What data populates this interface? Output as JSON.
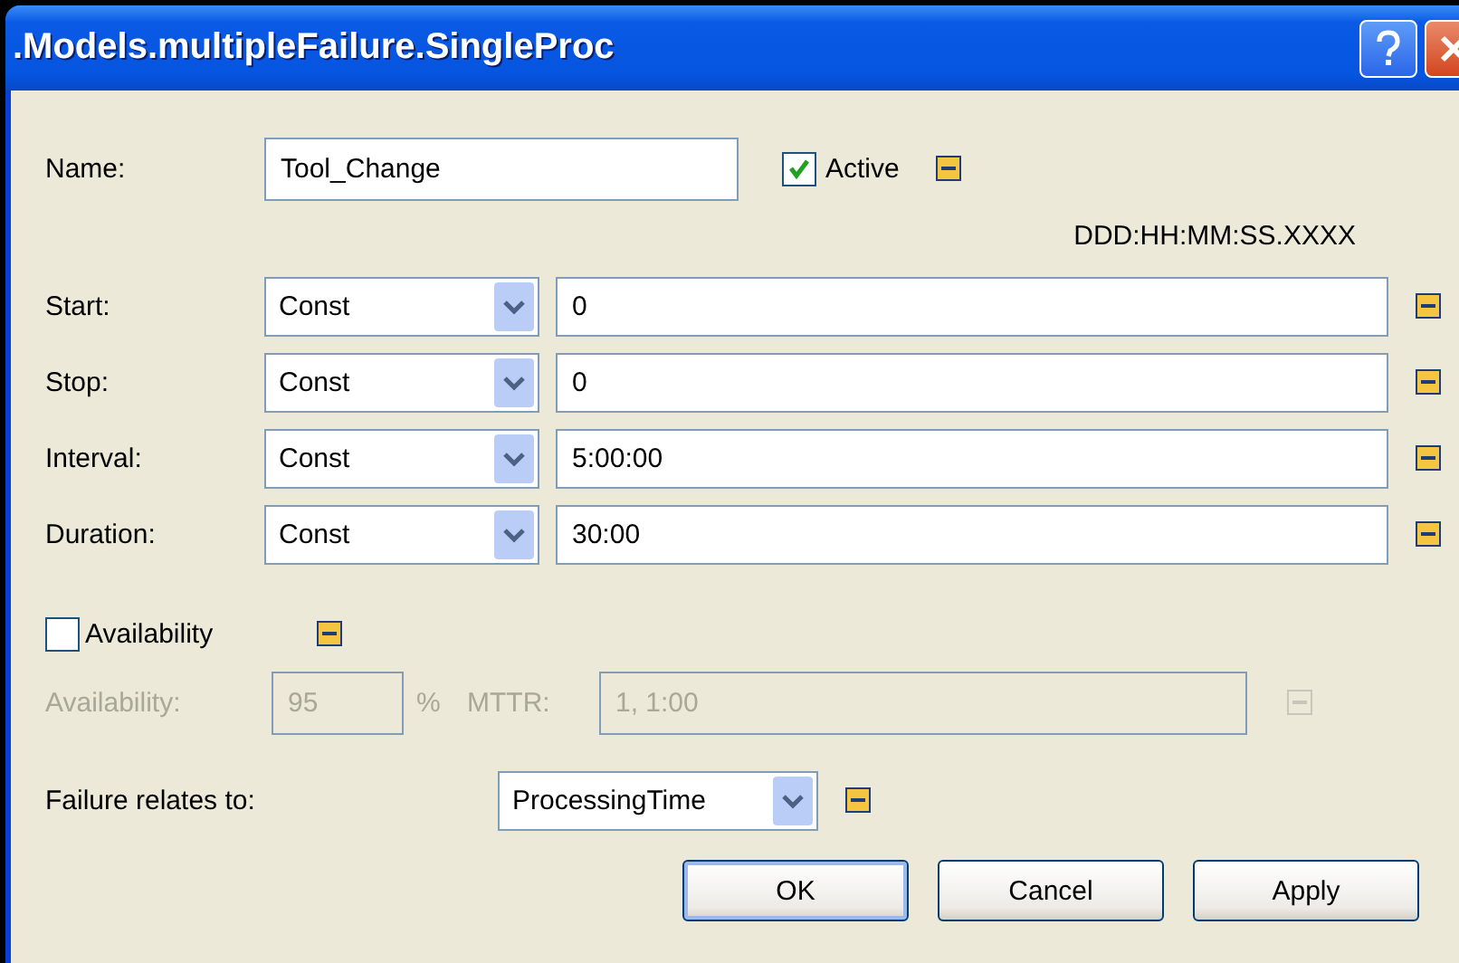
{
  "window": {
    "title": ".Models.multipleFailure.SingleProc"
  },
  "name": {
    "label": "Name:",
    "value": "Tool_Change"
  },
  "active": {
    "label": "Active",
    "checked": true
  },
  "format_hint": "DDD:HH:MM:SS.XXXX",
  "time_rows": [
    {
      "label": "Start:",
      "mode": "Const",
      "value": "0"
    },
    {
      "label": "Stop:",
      "mode": "Const",
      "value": "0"
    },
    {
      "label": "Interval:",
      "mode": "Const",
      "value": "5:00:00"
    },
    {
      "label": "Duration:",
      "mode": "Const",
      "value": "30:00"
    }
  ],
  "availability_toggle": {
    "label": "Availability",
    "checked": false
  },
  "availability_row": {
    "disabled": true,
    "label": "Availability:",
    "value": "95",
    "unit": "%",
    "mttr_label": "MTTR:",
    "mttr_value": "1, 1:00"
  },
  "relates": {
    "label": "Failure relates to:",
    "value": "ProcessingTime"
  },
  "buttons": [
    {
      "label": "OK",
      "default": true
    },
    {
      "label": "Cancel",
      "default": false
    },
    {
      "label": "Apply",
      "default": false
    }
  ]
}
